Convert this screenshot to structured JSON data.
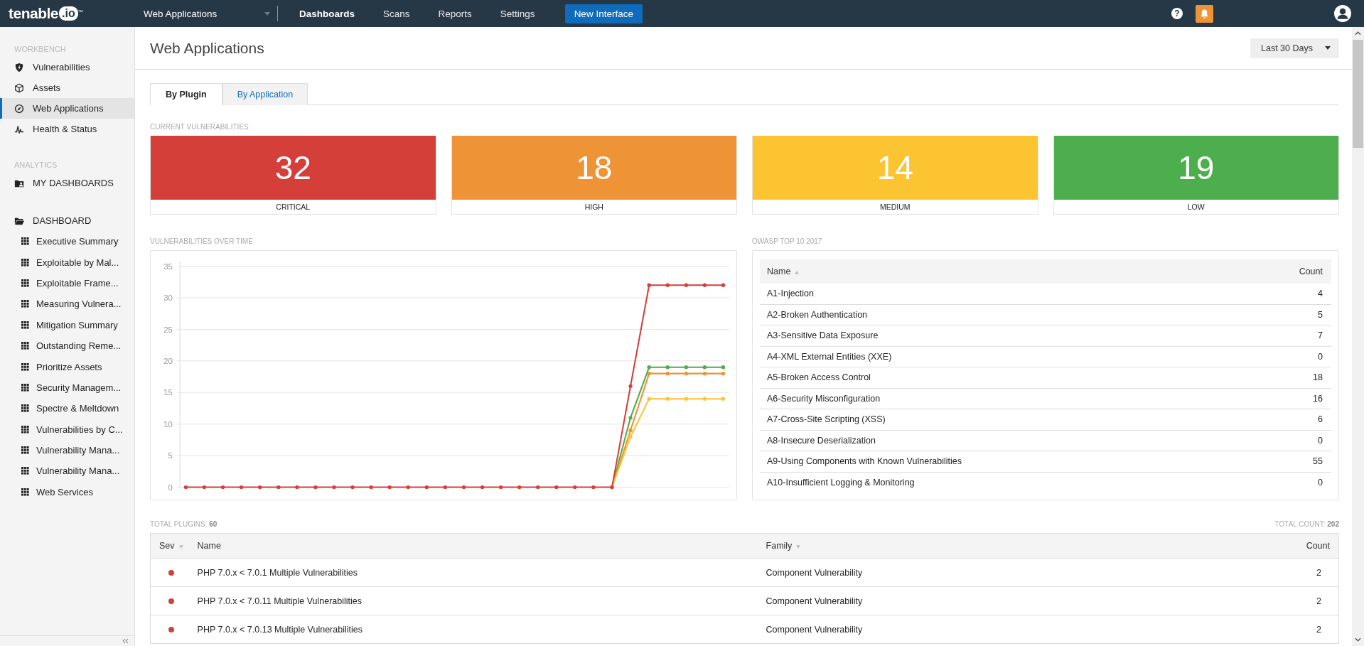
{
  "top_nav": {
    "logo": "tenable",
    "logo_mark": ".io",
    "trademark": "™",
    "help_icon": "?",
    "context_dropdown": "Web Applications",
    "items": [
      {
        "label": "Dashboards",
        "selected": true
      },
      {
        "label": "Scans",
        "selected": false
      },
      {
        "label": "Reports",
        "selected": false
      },
      {
        "label": "Settings",
        "selected": false
      }
    ],
    "new_interface_button": "New Interface"
  },
  "sidebar": {
    "sections": [
      {
        "heading": "WORKBENCH",
        "items": [
          {
            "label": "Vulnerabilities",
            "selected": false
          },
          {
            "label": "Assets",
            "selected": false
          },
          {
            "label": "Web Applications",
            "selected": true
          },
          {
            "label": "Health & Status",
            "selected": false
          }
        ]
      },
      {
        "heading": "ANALYTICS",
        "items": [
          {
            "label": "MY DASHBOARDS",
            "selected": false
          }
        ]
      }
    ],
    "dashboard_folder": {
      "label": "DASHBOARD",
      "expanded": true,
      "children": [
        {
          "label": "Executive Summary"
        },
        {
          "label": "Exploitable by Mal..."
        },
        {
          "label": "Exploitable Frame..."
        },
        {
          "label": "Measuring Vulnera..."
        },
        {
          "label": "Mitigation Summary"
        },
        {
          "label": "Outstanding Reme..."
        },
        {
          "label": "Prioritize Assets"
        },
        {
          "label": "Security Managem..."
        },
        {
          "label": "Spectre & Meltdown"
        },
        {
          "label": "Vulnerabilities by C..."
        },
        {
          "label": "Vulnerability Mana..."
        },
        {
          "label": "Vulnerability Mana..."
        },
        {
          "label": "Web Services"
        }
      ]
    }
  },
  "page": {
    "title": "Web Applications",
    "date_range": "Last 30 Days"
  },
  "tabs": [
    {
      "label": "By Plugin",
      "selected": true
    },
    {
      "label": "By Application",
      "selected": false
    }
  ],
  "current_vulnerabilities": {
    "heading": "CURRENT VULNERABILITIES",
    "tiles": [
      {
        "count": "32",
        "label": "CRITICAL",
        "color": "#d43f3a"
      },
      {
        "count": "18",
        "label": "HIGH",
        "color": "#ee9336"
      },
      {
        "count": "14",
        "label": "MEDIUM",
        "color": "#fdc431"
      },
      {
        "count": "19",
        "label": "LOW",
        "color": "#4cae4c"
      }
    ]
  },
  "vulnerabilities_over_time": {
    "heading": "VULNERABILITIES OVER TIME",
    "chart_data": {
      "type": "line",
      "grid": true,
      "ylim": [
        0,
        35
      ],
      "yticks": [
        0,
        5,
        10,
        15,
        20,
        25,
        30,
        35
      ],
      "series": [
        {
          "color": "#4cae4c",
          "values": [
            null,
            null,
            null,
            null,
            null,
            null,
            null,
            null,
            null,
            null,
            null,
            null,
            null,
            null,
            null,
            null,
            null,
            null,
            null,
            null,
            null,
            null,
            null,
            0,
            11,
            19,
            19,
            19,
            19,
            19
          ]
        },
        {
          "color": "#ee9336",
          "values": [
            null,
            null,
            null,
            null,
            null,
            null,
            null,
            null,
            null,
            null,
            null,
            null,
            null,
            null,
            null,
            null,
            null,
            null,
            null,
            null,
            null,
            null,
            null,
            0,
            9,
            18,
            18,
            18,
            18,
            18
          ]
        },
        {
          "color": "#fdc431",
          "values": [
            null,
            null,
            null,
            null,
            null,
            null,
            null,
            null,
            null,
            null,
            null,
            null,
            null,
            null,
            null,
            null,
            null,
            null,
            null,
            null,
            null,
            null,
            null,
            0,
            8,
            14,
            14,
            14,
            14,
            14
          ]
        },
        {
          "color": "#d43f3a",
          "values": [
            0,
            0,
            0,
            0,
            0,
            0,
            0,
            0,
            0,
            0,
            0,
            0,
            0,
            0,
            0,
            0,
            0,
            0,
            0,
            0,
            0,
            0,
            0,
            0,
            16,
            32,
            32,
            32,
            32,
            32
          ]
        }
      ]
    }
  },
  "owasp_top_10": {
    "heading": "OWASP TOP 10 2017",
    "columns": [
      {
        "label": "Name",
        "sort_indicator": true
      },
      {
        "label": "Count",
        "sort_indicator": false
      }
    ],
    "rows": [
      {
        "name": "A1-Injection",
        "count": "4"
      },
      {
        "name": "A2-Broken Authentication",
        "count": "5"
      },
      {
        "name": "A3-Sensitive Data Exposure",
        "count": "7"
      },
      {
        "name": "A4-XML External Entities (XXE)",
        "count": "0"
      },
      {
        "name": "A5-Broken Access Control",
        "count": "18"
      },
      {
        "name": "A6-Security Misconfiguration",
        "count": "16"
      },
      {
        "name": "A7-Cross-Site Scripting (XSS)",
        "count": "6"
      },
      {
        "name": "A8-Insecure Deserialization",
        "count": "0"
      },
      {
        "name": "A9-Using Components with Known Vulnerabilities",
        "count": "55"
      },
      {
        "name": "A10-Insufficient Logging & Monitoring",
        "count": "0"
      }
    ]
  },
  "plugins": {
    "total_plugins": "TOTAL PLUGINS: **60**",
    "total_count": "TOTAL COUNT: **202**",
    "columns": [
      {
        "label": "Sev",
        "sort_indicator": true
      },
      {
        "label": "Name",
        "sort_indicator": false
      },
      {
        "label": "Family",
        "sort_indicator": true
      },
      {
        "label": "Count",
        "sort_indicator": false
      }
    ],
    "rows": [
      {
        "color": "#d43f3a",
        "name": "PHP 7.0.x < 7.0.1 Multiple Vulnerabilities",
        "family": "Component Vulnerability",
        "count": "2"
      },
      {
        "color": "#d43f3a",
        "name": "PHP 7.0.x < 7.0.11 Multiple Vulnerabilities",
        "family": "Component Vulnerability",
        "count": "2"
      },
      {
        "color": "#d43f3a",
        "name": "PHP 7.0.x < 7.0.13 Multiple Vulnerabilities",
        "family": "Component Vulnerability",
        "count": "2"
      }
    ]
  }
}
